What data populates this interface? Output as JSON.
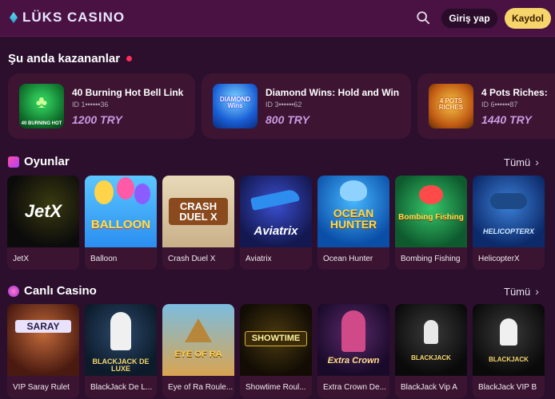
{
  "header": {
    "logo_text": "LÜKS CASINO",
    "login_label": "Giriş yap",
    "signup_label": "Kaydol"
  },
  "winners": {
    "title": "Şu anda kazananlar",
    "items": [
      {
        "game": "40 Burning Hot Bell Link",
        "id": "ID 1••••••36",
        "amount": "1200 TRY",
        "thumb_text": "40 BURNING HOT"
      },
      {
        "game": "Diamond Wins: Hold and Win",
        "id": "ID 3••••••62",
        "amount": "800 TRY",
        "thumb_text": "DIAMOND Wins"
      },
      {
        "game": "4 Pots Riches:",
        "id": "ID 6••••••87",
        "amount": "1440 TRY",
        "thumb_text": "4 POTS RICHES"
      }
    ]
  },
  "games": {
    "title": "Oyunlar",
    "see_all": "Tümü",
    "items": [
      {
        "label": "JetX",
        "art": "JetX"
      },
      {
        "label": "Balloon",
        "art": "BALLOON"
      },
      {
        "label": "Crash Duel X",
        "art": "CRASH DUEL X"
      },
      {
        "label": "Aviatrix",
        "art": "Aviatrix"
      },
      {
        "label": "Ocean Hunter",
        "art": "OCEAN HUNTER"
      },
      {
        "label": "Bombing Fishing",
        "art": "Bombing Fishing"
      },
      {
        "label": "HelicopterX",
        "art": "HELICOPTERX"
      }
    ]
  },
  "live": {
    "title": "Canlı Casino",
    "see_all": "Tümü",
    "items": [
      {
        "label": "VIP Saray Rulet",
        "art": "SARAY"
      },
      {
        "label": "BlackJack De L...",
        "art": "BLACKJACK DE LUXE"
      },
      {
        "label": "Eye of Ra Roule...",
        "art": "EYE OF RA"
      },
      {
        "label": "Showtime Roul...",
        "art": "SHOWTIME"
      },
      {
        "label": "Extra Crown De...",
        "art": "Extra Crown"
      },
      {
        "label": "BlackJack Vip A",
        "art": "BLACKJACK"
      },
      {
        "label": "BlackJack VIP B",
        "art": "BLACKJACK"
      }
    ]
  }
}
